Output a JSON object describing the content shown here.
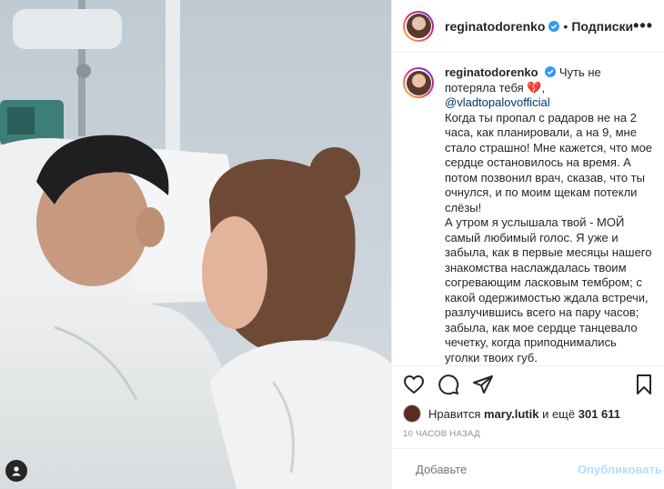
{
  "header": {
    "username": "reginatodorenko",
    "separator": "•",
    "follow_label": "Подписки",
    "more_label": "•••"
  },
  "caption": {
    "username": "reginatodorenko",
    "lead": "Чуть не потеряла тебя",
    "heart": "💔",
    "comma": ",",
    "mention": "@vladtopalovofficial",
    "paragraphs": [
      "Когда ты пропал с радаров не на 2 часа, как планировали, а на 9, мне стало страшно! Мне кажется, что мое сердце остановилось на время. А потом позвонил врач, сказав, что ты очнулся, и по моим щекам потекли слёзы!",
      "А утром я услышала твой - МОЙ самый любимый голос. Я уже и забыла, как в первые месяцы нашего знакомства наслаждалась твоим согревающим ласковым тембром; с какой одержимостью ждала встречи, разлучившись всего на пару часов; забыла, как мое сердце танцевало чечетку, когда приподнимались уголки твоих губ."
    ]
  },
  "likes": {
    "prefix": "Нравится",
    "user": "mary.lutik",
    "and": "и ещё",
    "count": "301 611"
  },
  "timestamp": "10 часов назад",
  "comment_box": {
    "placeholder": "Добавьте",
    "publish_label": "Опубликовать"
  },
  "icons": {
    "like": "heart-icon",
    "comment": "comment-icon",
    "share": "paper-plane-icon",
    "save": "bookmark-icon",
    "emoji": "smiley-icon",
    "tag": "user-tag-icon",
    "verified": "verified-badge-icon"
  },
  "colors": {
    "verified": "#3897f0",
    "mention": "#00376b",
    "publish_disabled": "#b2dffc",
    "muted": "#8e8e8e"
  }
}
